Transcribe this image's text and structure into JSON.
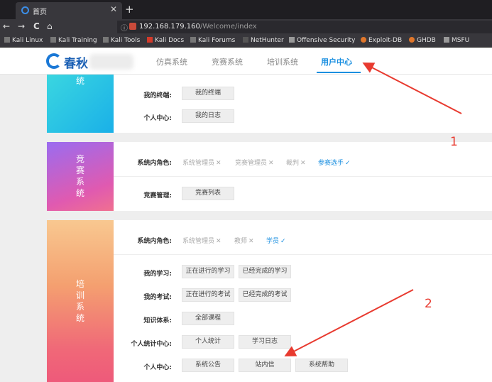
{
  "browser": {
    "tab_title": "首页",
    "tab_close": "✕",
    "new_tab": "+",
    "back": "←",
    "forward": "→",
    "reload": "C",
    "home": "⌂",
    "url_host": "192.168.179.160",
    "url_path": "/Welcome/index",
    "bookmarks": [
      "Kali Linux",
      "Kali Training",
      "Kali Tools",
      "Kali Docs",
      "Kali Forums",
      "NetHunter",
      "Offensive Security",
      "Exploit-DB",
      "GHDB",
      "MSFU"
    ]
  },
  "header": {
    "logo_text": "春秋",
    "nav": [
      "仿真系统",
      "竞赛系统",
      "培训系统",
      "用户中心"
    ],
    "active_nav": "用户中心"
  },
  "sim_card": {
    "label_partial": "统",
    "rows": [
      {
        "label": "我的终端:",
        "buttons": [
          "我的终端"
        ]
      },
      {
        "label": "个人中心:",
        "buttons": [
          "我的日志"
        ]
      }
    ]
  },
  "contest_card": {
    "label": [
      "竞",
      "赛",
      "系",
      "统"
    ],
    "roles_label": "系统内角色:",
    "roles": [
      {
        "name": "系统管理员",
        "mark": "✕"
      },
      {
        "name": "竞赛管理员",
        "mark": "✕"
      },
      {
        "name": "裁判",
        "mark": "✕"
      },
      {
        "name": "参赛选手",
        "mark": "✓"
      }
    ],
    "manage_label": "竞赛管理:",
    "manage_buttons": [
      "竞赛列表"
    ]
  },
  "training_card": {
    "label": [
      "培",
      "训",
      "系",
      "统"
    ],
    "roles_label": "系统内角色:",
    "roles": [
      {
        "name": "系统管理员",
        "mark": "✕"
      },
      {
        "name": "教师",
        "mark": "✕"
      },
      {
        "name": "学员",
        "mark": "✓"
      }
    ],
    "rows": [
      {
        "label": "我的学习:",
        "buttons": [
          "正在进行的学习",
          "已经完成的学习"
        ]
      },
      {
        "label": "我的考试:",
        "buttons": [
          "正在进行的考试",
          "已经完成的考试"
        ]
      },
      {
        "label": "知识体系:",
        "buttons": [
          "全部课程"
        ]
      },
      {
        "label": "个人统计中心:",
        "buttons": [
          "个人统计",
          "学习日志"
        ]
      },
      {
        "label": "个人中心:",
        "buttons": [
          "系统公告",
          "站内信",
          "系统帮助"
        ]
      }
    ]
  },
  "annotations": {
    "num1": "1",
    "num2": "2",
    "color": "#e83a2f"
  }
}
